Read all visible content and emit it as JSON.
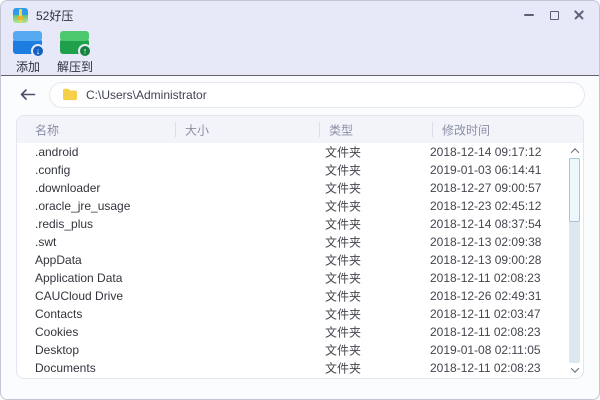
{
  "window": {
    "title": "52好压"
  },
  "toolbar": {
    "buttons": [
      {
        "label": "添加",
        "icon": "archive-add-icon",
        "arrow": "↓"
      },
      {
        "label": "解压到",
        "icon": "archive-extract-icon",
        "arrow": "↑"
      }
    ]
  },
  "address_bar": {
    "path": "C:\\Users\\Administrator"
  },
  "file_list": {
    "columns": [
      "名称",
      "大小",
      "类型",
      "修改时间"
    ],
    "rows": [
      {
        "name": ".android",
        "size": "",
        "type": "文件夹",
        "modified": "2018-12-14 09:17:12"
      },
      {
        "name": ".config",
        "size": "",
        "type": "文件夹",
        "modified": "2019-01-03 06:14:41"
      },
      {
        "name": ".downloader",
        "size": "",
        "type": "文件夹",
        "modified": "2018-12-27 09:00:57"
      },
      {
        "name": ".oracle_jre_usage",
        "size": "",
        "type": "文件夹",
        "modified": "2018-12-23 02:45:12"
      },
      {
        "name": ".redis_plus",
        "size": "",
        "type": "文件夹",
        "modified": "2018-12-14 08:37:54"
      },
      {
        "name": ".swt",
        "size": "",
        "type": "文件夹",
        "modified": "2018-12-13 02:09:38"
      },
      {
        "name": "AppData",
        "size": "",
        "type": "文件夹",
        "modified": "2018-12-13 09:00:28"
      },
      {
        "name": "Application Data",
        "size": "",
        "type": "文件夹",
        "modified": "2018-12-11 02:08:23"
      },
      {
        "name": "CAUCloud Drive",
        "size": "",
        "type": "文件夹",
        "modified": "2018-12-26 02:49:31"
      },
      {
        "name": "Contacts",
        "size": "",
        "type": "文件夹",
        "modified": "2018-12-11 02:03:47"
      },
      {
        "name": "Cookies",
        "size": "",
        "type": "文件夹",
        "modified": "2018-12-11 02:08:23"
      },
      {
        "name": "Desktop",
        "size": "",
        "type": "文件夹",
        "modified": "2019-01-08 02:11:05"
      },
      {
        "name": "Documents",
        "size": "",
        "type": "文件夹",
        "modified": "2018-12-11 02:08:23"
      }
    ]
  },
  "colors": {
    "titlebar_bg": "#e7e8f8",
    "add_icon_blue": "#1d7de0",
    "extract_icon_green": "#1fa14c",
    "folder_yellow": "#f6cf4b",
    "header_text": "#8a8fa8",
    "divider_dark": "#63636f"
  }
}
